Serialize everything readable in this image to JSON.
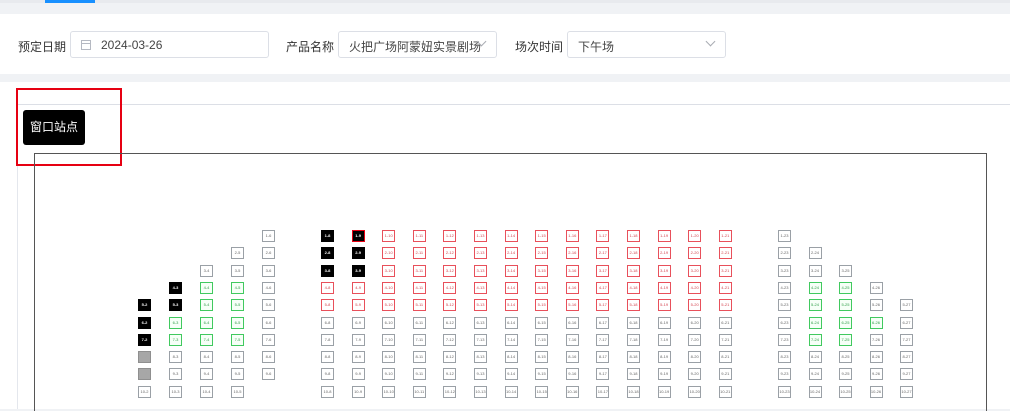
{
  "filters": {
    "date_label": "预定日期",
    "date_value": "2024-03-26",
    "product_label": "产品名称",
    "product_value": "火把广场阿蒙妞实景剧场",
    "session_label": "场次时间",
    "session_value": "下午场"
  },
  "window_point_button": "窗口站点",
  "seat_grid": {
    "rows": [
      {
        "label": "1",
        "cols": [
          6,
          8,
          9,
          10,
          11,
          12,
          13,
          14,
          15,
          16,
          17,
          18,
          19,
          20,
          21,
          23
        ],
        "status": {
          "8": "sold",
          "9": "sold-red",
          "10": "locked",
          "11": "locked",
          "12": "locked",
          "13": "locked",
          "14": "locked",
          "15": "locked",
          "16": "locked",
          "17": "locked",
          "18": "locked",
          "19": "locked",
          "20": "locked",
          "21": "locked"
        }
      },
      {
        "label": "2",
        "cols": [
          5,
          6,
          8,
          9,
          10,
          11,
          12,
          13,
          14,
          15,
          16,
          17,
          18,
          19,
          20,
          21,
          23,
          24
        ],
        "status": {
          "8": "sold",
          "9": "sold",
          "10": "locked",
          "11": "locked",
          "12": "locked",
          "13": "locked",
          "14": "locked",
          "15": "locked",
          "16": "locked",
          "17": "locked",
          "18": "locked",
          "19": "locked",
          "20": "locked",
          "21": "locked"
        }
      },
      {
        "label": "3",
        "cols": [
          4,
          5,
          6,
          8,
          9,
          10,
          11,
          12,
          13,
          14,
          15,
          16,
          17,
          18,
          19,
          20,
          21,
          23,
          24,
          25
        ],
        "status": {
          "8": "sold",
          "9": "sold",
          "10": "locked",
          "11": "locked",
          "12": "locked",
          "13": "locked",
          "14": "locked",
          "15": "locked",
          "16": "locked",
          "17": "locked",
          "18": "locked",
          "19": "locked",
          "20": "locked",
          "21": "locked"
        }
      },
      {
        "label": "4",
        "cols": [
          3,
          4,
          5,
          6,
          8,
          9,
          10,
          11,
          12,
          13,
          14,
          15,
          16,
          17,
          18,
          19,
          20,
          21,
          23,
          24,
          25,
          26
        ],
        "status": {
          "3": "sold",
          "4": "green",
          "5": "green",
          "8": "locked",
          "9": "locked",
          "10": "locked",
          "11": "locked",
          "12": "locked",
          "13": "locked",
          "14": "locked",
          "15": "locked",
          "16": "locked",
          "17": "locked",
          "18": "locked",
          "19": "locked",
          "20": "locked",
          "21": "locked",
          "24": "green",
          "25": "green"
        }
      },
      {
        "label": "5",
        "cols": [
          2,
          3,
          4,
          5,
          6,
          8,
          9,
          10,
          11,
          12,
          13,
          14,
          15,
          16,
          17,
          18,
          19,
          20,
          21,
          23,
          24,
          25,
          26,
          27
        ],
        "status": {
          "2": "sold",
          "3": "sold",
          "4": "green",
          "5": "green",
          "8": "locked",
          "9": "locked",
          "10": "locked",
          "11": "locked",
          "12": "locked",
          "13": "locked",
          "14": "locked",
          "15": "locked",
          "16": "locked",
          "17": "locked",
          "18": "locked",
          "19": "locked",
          "20": "locked",
          "21": "locked",
          "24": "green",
          "25": "green"
        }
      },
      {
        "label": "6",
        "cols": [
          2,
          3,
          4,
          5,
          6,
          8,
          9,
          10,
          11,
          12,
          13,
          14,
          15,
          16,
          17,
          18,
          19,
          20,
          21,
          23,
          24,
          25,
          26,
          27
        ],
        "status": {
          "2": "sold",
          "3": "green",
          "4": "green",
          "5": "green",
          "24": "green",
          "25": "green",
          "26": "green"
        }
      },
      {
        "label": "7",
        "cols": [
          2,
          3,
          4,
          5,
          6,
          8,
          9,
          10,
          11,
          12,
          13,
          14,
          15,
          16,
          17,
          18,
          19,
          20,
          21,
          23,
          24,
          25,
          26,
          27
        ],
        "status": {
          "2": "sold",
          "3": "green",
          "4": "green",
          "5": "green",
          "24": "green",
          "25": "green"
        }
      },
      {
        "label": "8",
        "cols": [
          2,
          3,
          4,
          5,
          6,
          8,
          9,
          10,
          11,
          12,
          13,
          14,
          15,
          16,
          17,
          18,
          19,
          20,
          21,
          23,
          24,
          25,
          26,
          27
        ],
        "status": {
          "2": "gray"
        }
      },
      {
        "label": "9",
        "cols": [
          2,
          3,
          4,
          5,
          6,
          8,
          9,
          10,
          11,
          12,
          13,
          14,
          15,
          16,
          17,
          18,
          19,
          20,
          21,
          23,
          24,
          25,
          26,
          27
        ],
        "status": {
          "2": "gray"
        }
      },
      {
        "label": "10",
        "cols": [
          2,
          3,
          4,
          5,
          8,
          9,
          10,
          11,
          12,
          13,
          14,
          15,
          16,
          17,
          18,
          19,
          20,
          21,
          23,
          24,
          25,
          26,
          27
        ],
        "status": {}
      }
    ]
  },
  "colors": {
    "sold": "#000000",
    "locked_border": "#e8505b",
    "available_green": "#41c95f",
    "unavailable_gray": "#a7a7a7",
    "highlight_red": "#e60012",
    "accent": "#1890ff"
  }
}
